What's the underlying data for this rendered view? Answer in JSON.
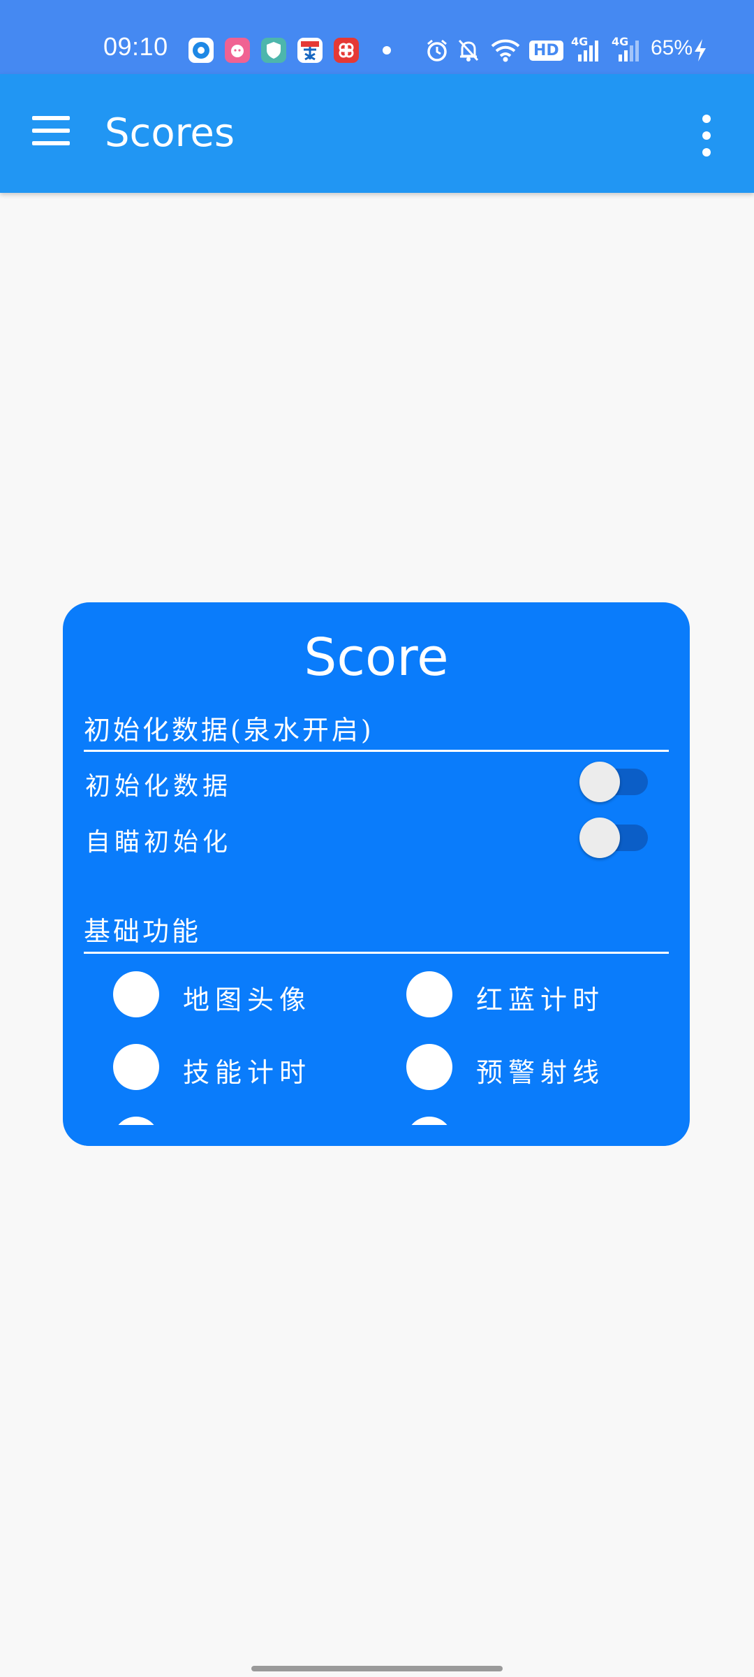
{
  "status_bar": {
    "time": "09:10",
    "battery": "65%",
    "background_color": "#4589f2",
    "app_icons": [
      {
        "name": "circle-app-icon",
        "color": "#1e88e5",
        "glyph": "◉"
      },
      {
        "name": "pig-app-icon",
        "color": "#f06292",
        "glyph": "☺"
      },
      {
        "name": "shield-app-icon",
        "color": "#4db6ac",
        "glyph": "$"
      },
      {
        "name": "mai-app-icon",
        "color": "#ff7043",
        "glyph": "麦"
      },
      {
        "name": "pinduoduo-app-icon",
        "color": "#e53935",
        "glyph": "∞"
      }
    ],
    "system_icons": [
      "alarm-icon",
      "mute-bell-icon",
      "wifi-icon",
      "hd-icon",
      "signal-4g-icon",
      "signal-4g-icon-2",
      "charging-icon"
    ],
    "hd_label": "HD",
    "net_label": "4G"
  },
  "app_bar": {
    "title": "Scores",
    "background_color": "#2196f3"
  },
  "dialog": {
    "title": "Score",
    "background_color": "#0a7cfb",
    "section_init": {
      "header": "初始化数据(泉水开启)",
      "rows": [
        {
          "label": "初始化数据",
          "enabled": false
        },
        {
          "label": "自瞄初始化",
          "enabled": false
        }
      ]
    },
    "section_basic": {
      "header": "基础功能",
      "options": [
        {
          "label": "地图头像"
        },
        {
          "label": "红蓝计时"
        },
        {
          "label": "技能计时"
        },
        {
          "label": "预警射线"
        }
      ]
    }
  }
}
